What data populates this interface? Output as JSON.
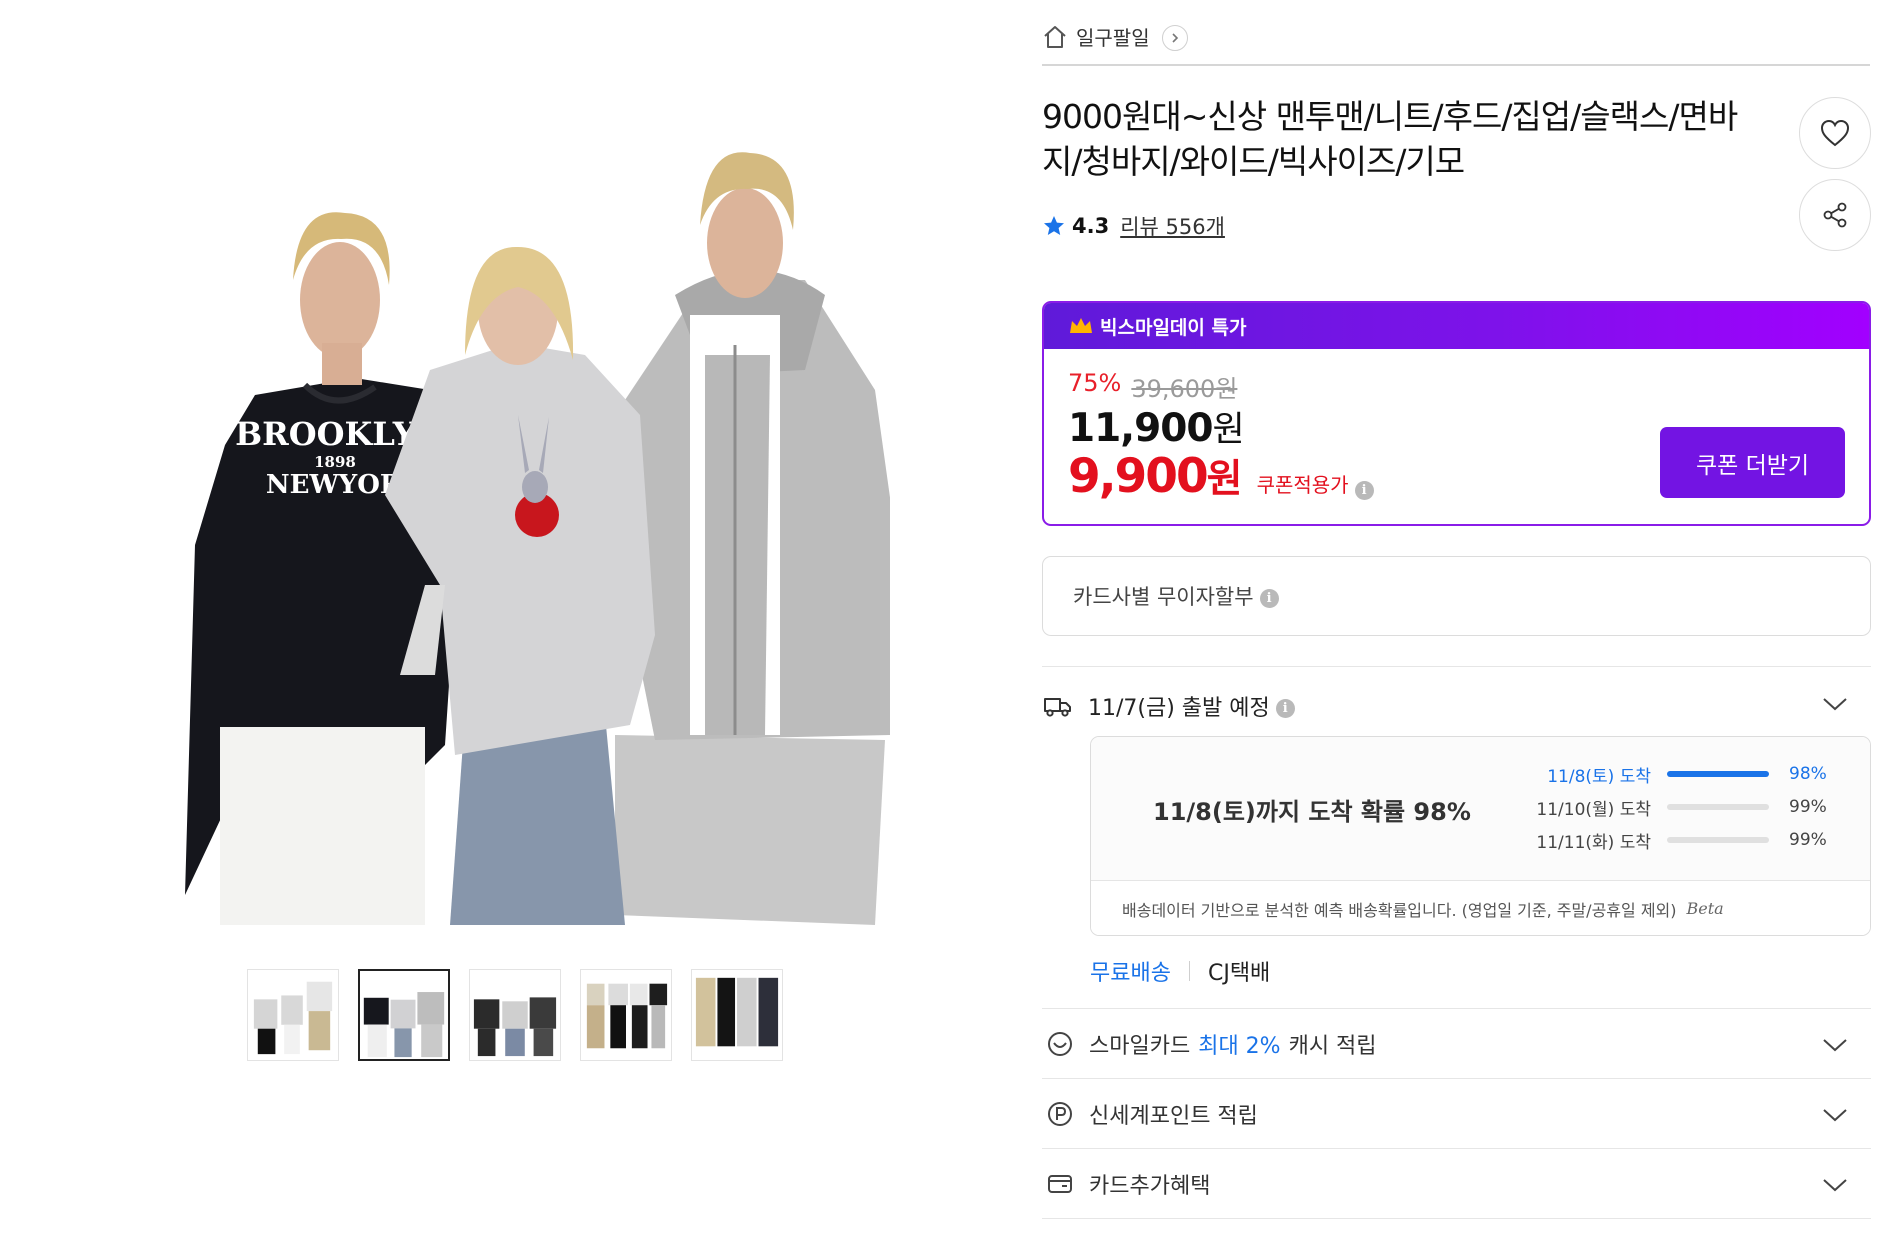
{
  "breadcrumb": {
    "shop_name": "일구팔일"
  },
  "product": {
    "title": "9000원대~신상 맨투맨/니트/후드/집업/슬랙스/면바지/청바지/와이드/빅사이즈/기모",
    "rating": "4.3",
    "review_count_label": "리뷰 556개"
  },
  "main_image": {
    "print_line1": "BROOKLYN",
    "print_line2": "1898",
    "print_line3": "NEWYORK"
  },
  "thumbnails": {
    "count": 5,
    "selected_index": 1
  },
  "deal": {
    "header_label": "빅스마일데이 특가",
    "discount_percent": "75%",
    "original_price": "39,600원",
    "sale_price": "11,900",
    "sale_unit": "원",
    "coupon_price": "9,900",
    "coupon_unit": "원",
    "coupon_note": "쿠폰적용가",
    "coupon_button_label": "쿠폰 더받기"
  },
  "installment": {
    "label": "카드사별 무이자할부"
  },
  "shipping": {
    "departure": "11/7(금) 출발 예정",
    "arrival_headline": "11/8(토)까지 도착 확률 98%",
    "probabilities": [
      {
        "label": "11/8(토) 도착",
        "percent": "98%",
        "value": 0.98
      },
      {
        "label": "11/10(월) 도착",
        "percent": "99%",
        "value": 0.99
      },
      {
        "label": "11/11(화) 도착",
        "percent": "99%",
        "value": 0.99
      }
    ],
    "footnote": "배송데이터 기반으로 분석한 예측 배송확률입니다. (영업일 기준, 주말/공휴일 제외)",
    "beta_label": "Beta",
    "free_shipping": "무료배송",
    "carrier": "CJ택배"
  },
  "benefits": {
    "smile_card_prefix": "스마일카드",
    "smile_card_highlight": "최대 2%",
    "smile_card_suffix": "캐시 적립",
    "shinsegae_point": "신세계포인트 적립",
    "card_extra": "카드추가혜택"
  },
  "colors": {
    "brand_purple": "#7314e3",
    "deal_gradient_start": "#5f1ad9",
    "deal_gradient_end": "#a200ff",
    "price_red": "#e3101e",
    "discount_red": "#e8202a",
    "link_blue": "#1a73e8",
    "rating_star_blue": "#1a73e8",
    "crown_gold": "#ffb400"
  },
  "icons": {
    "home": "home-icon",
    "breadcrumb_chevron": "chevron-right-icon",
    "wish": "heart-icon",
    "share": "share-icon",
    "rating": "star-icon",
    "deal": "crown-icon",
    "info": "info-icon",
    "shipping": "truck-icon",
    "smile_card": "smile-icon",
    "point": "point-p-icon",
    "card": "card-icon",
    "expand": "chevron-down-icon"
  }
}
